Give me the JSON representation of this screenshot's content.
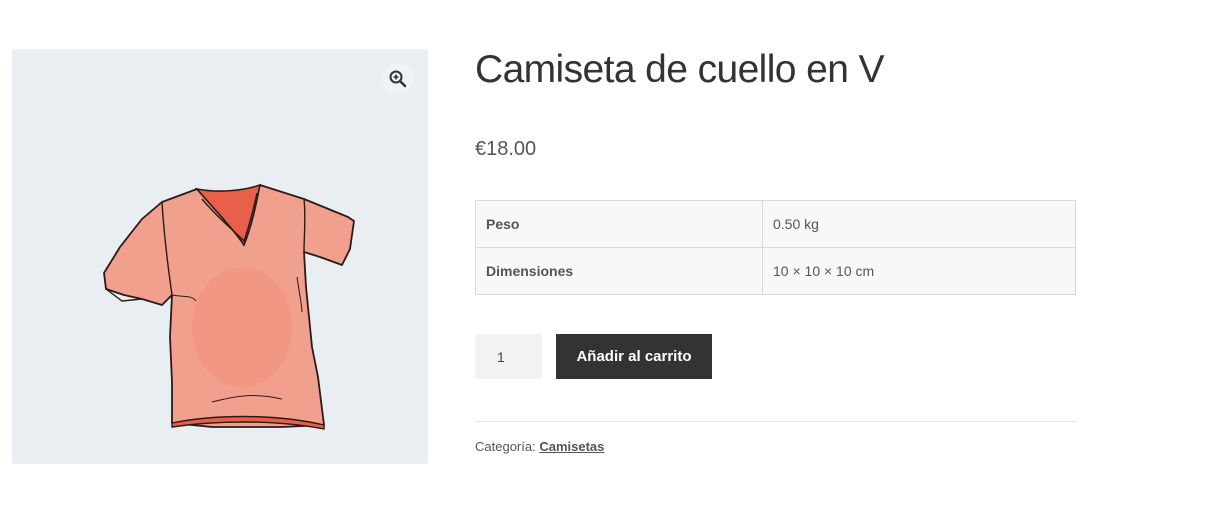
{
  "product": {
    "title": "Camiseta de cuello en V",
    "price": "€18.00",
    "image_alt": "red v-neck t-shirt illustration"
  },
  "attributes": [
    {
      "label": "Peso",
      "value": "0.50 kg"
    },
    {
      "label": "Dimensiones",
      "value": "10 × 10 × 10 cm"
    }
  ],
  "cart": {
    "quantity": "1",
    "add_label": "Añadir al carrito"
  },
  "meta": {
    "category_label": "Categoría:",
    "category_link": "Camisetas"
  },
  "icons": {
    "zoom": "zoom-in-icon"
  },
  "colors": {
    "button_bg": "#333333",
    "gallery_bg": "#e9eef2",
    "shirt": "#f08a76"
  }
}
